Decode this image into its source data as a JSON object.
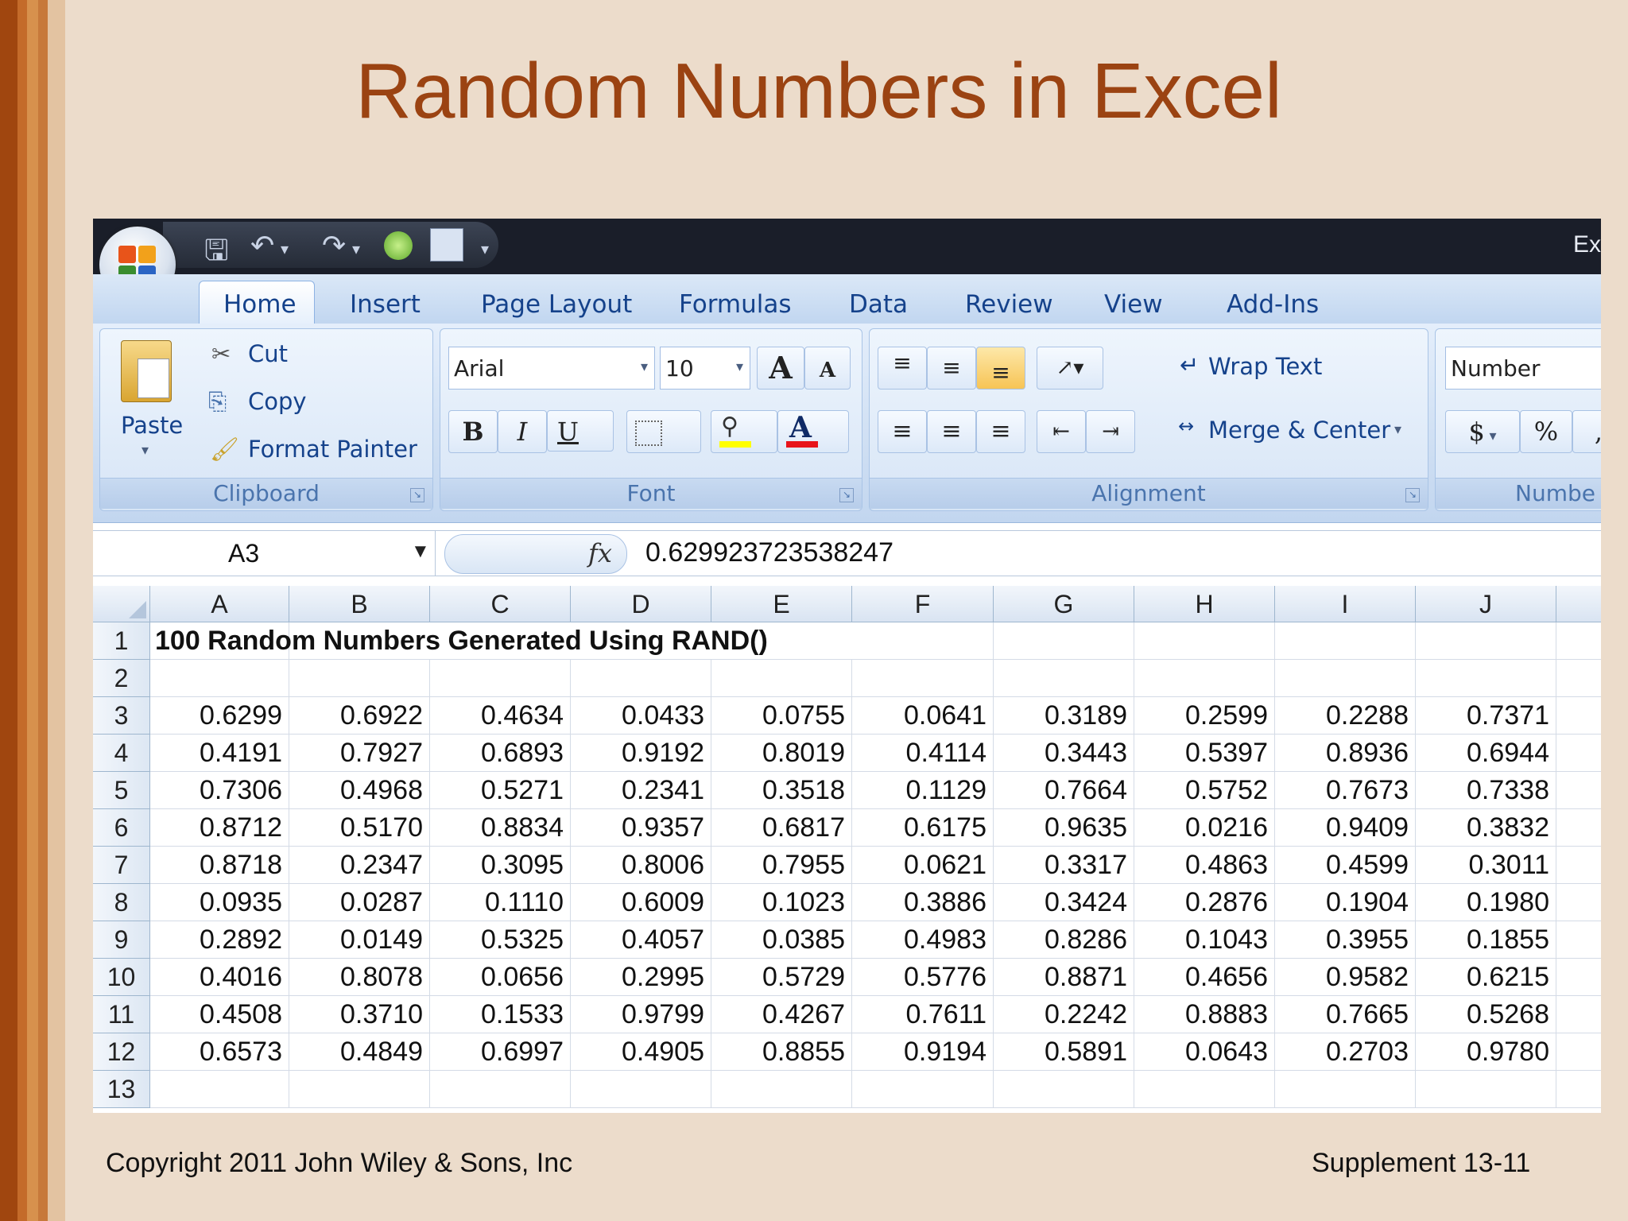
{
  "slide": {
    "title": "Random Numbers in Excel",
    "footer_left": "Copyright 2011 John Wiley & Sons, Inc",
    "footer_right": "Supplement 13-11"
  },
  "excel": {
    "window_title": "Ex",
    "quick_access": {
      "save_icon": "save-icon",
      "undo_icon": "undo-icon",
      "redo_icon": "redo-icon"
    },
    "tabs": [
      "Home",
      "Insert",
      "Page Layout",
      "Formulas",
      "Data",
      "Review",
      "View",
      "Add-Ins"
    ],
    "active_tab": "Home",
    "ribbon": {
      "clipboard": {
        "label": "Clipboard",
        "paste": "Paste",
        "cut": "Cut",
        "copy": "Copy",
        "format_painter": "Format Painter"
      },
      "font": {
        "label": "Font",
        "font_name": "Arial",
        "font_size": "10",
        "bold": "B",
        "italic": "I",
        "underline": "U",
        "grow": "A",
        "shrink": "A",
        "font_color": "A"
      },
      "alignment": {
        "label": "Alignment",
        "wrap_text": "Wrap Text",
        "merge_center": "Merge & Center"
      },
      "number": {
        "label": "Numbe",
        "format": "Number",
        "currency": "$",
        "percent": "%",
        "comma": ","
      }
    },
    "formula_bar": {
      "name_box": "A3",
      "fx": "fx",
      "value": "0.629923723538247"
    },
    "columns": [
      "A",
      "B",
      "C",
      "D",
      "E",
      "F",
      "G",
      "H",
      "I",
      "J"
    ],
    "rows": [
      "1",
      "2",
      "3",
      "4",
      "5",
      "6",
      "7",
      "8",
      "9",
      "10",
      "11",
      "12",
      "13"
    ],
    "row1_text": "100 Random Numbers Generated Using RAND()",
    "data": [
      [
        "0.6299",
        "0.6922",
        "0.4634",
        "0.0433",
        "0.0755",
        "0.0641",
        "0.3189",
        "0.2599",
        "0.2288",
        "0.7371"
      ],
      [
        "0.4191",
        "0.7927",
        "0.6893",
        "0.9192",
        "0.8019",
        "0.4114",
        "0.3443",
        "0.5397",
        "0.8936",
        "0.6944"
      ],
      [
        "0.7306",
        "0.4968",
        "0.5271",
        "0.2341",
        "0.3518",
        "0.1129",
        "0.7664",
        "0.5752",
        "0.7673",
        "0.7338"
      ],
      [
        "0.8712",
        "0.5170",
        "0.8834",
        "0.9357",
        "0.6817",
        "0.6175",
        "0.9635",
        "0.0216",
        "0.9409",
        "0.3832"
      ],
      [
        "0.8718",
        "0.2347",
        "0.3095",
        "0.8006",
        "0.7955",
        "0.0621",
        "0.3317",
        "0.4863",
        "0.4599",
        "0.3011"
      ],
      [
        "0.0935",
        "0.0287",
        "0.1110",
        "0.6009",
        "0.1023",
        "0.3886",
        "0.3424",
        "0.2876",
        "0.1904",
        "0.1980"
      ],
      [
        "0.2892",
        "0.0149",
        "0.5325",
        "0.4057",
        "0.0385",
        "0.4983",
        "0.8286",
        "0.1043",
        "0.3955",
        "0.1855"
      ],
      [
        "0.4016",
        "0.8078",
        "0.0656",
        "0.2995",
        "0.5729",
        "0.5776",
        "0.8871",
        "0.4656",
        "0.9582",
        "0.6215"
      ],
      [
        "0.4508",
        "0.3710",
        "0.1533",
        "0.9799",
        "0.4267",
        "0.7611",
        "0.2242",
        "0.8883",
        "0.7665",
        "0.5268"
      ],
      [
        "0.6573",
        "0.4849",
        "0.6997",
        "0.4905",
        "0.8855",
        "0.9194",
        "0.5891",
        "0.0643",
        "0.2703",
        "0.9780"
      ]
    ]
  }
}
